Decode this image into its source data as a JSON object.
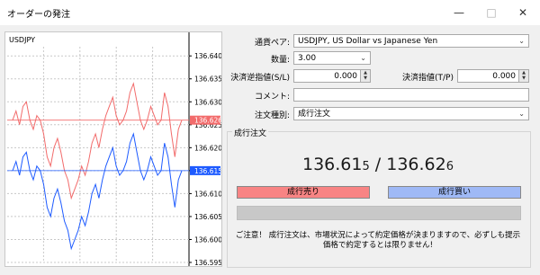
{
  "window": {
    "title": "オーダーの発注",
    "minimize": "—",
    "maximize": "□",
    "close": "✕"
  },
  "chart": {
    "symbol": "USDJPY",
    "ticks": [
      "136.640",
      "136.635",
      "136.630",
      "136.625",
      "136.620",
      "136.615",
      "136.610",
      "136.605",
      "136.600",
      "136.595"
    ],
    "ask_label": "136.626",
    "bid_label": "136.615",
    "colors": {
      "ask": "#f26b6b",
      "bid": "#1e5bff"
    }
  },
  "chart_data": {
    "type": "line",
    "title": "USDJPY",
    "ylim": [
      136.595,
      136.642
    ],
    "series": [
      {
        "values": [
          136.626,
          136.628,
          136.625,
          136.629,
          136.63,
          136.626,
          136.624,
          136.627,
          136.626,
          136.623,
          136.618,
          136.616,
          136.62,
          136.622,
          136.619,
          136.615,
          136.613,
          136.609,
          136.611,
          136.613,
          136.616,
          136.614,
          136.617,
          136.621,
          136.623,
          136.62,
          136.624,
          136.627,
          136.629,
          136.631,
          136.627,
          136.625,
          136.626,
          136.628,
          136.632,
          136.634,
          136.63,
          136.626,
          136.624,
          136.626,
          136.629,
          136.627,
          136.625,
          136.626,
          136.632,
          136.629,
          136.623,
          136.618,
          136.624,
          136.626
        ]
      },
      {
        "values": [
          136.615,
          136.617,
          136.614,
          136.618,
          136.619,
          136.615,
          136.613,
          136.616,
          136.615,
          136.612,
          136.607,
          136.605,
          136.609,
          136.611,
          136.608,
          136.604,
          136.602,
          136.598,
          136.6,
          136.602,
          136.605,
          136.603,
          136.606,
          136.61,
          136.612,
          136.609,
          136.613,
          136.616,
          136.618,
          136.62,
          136.616,
          136.614,
          136.615,
          136.617,
          136.621,
          136.623,
          136.619,
          136.615,
          136.613,
          136.615,
          136.618,
          136.616,
          136.614,
          136.615,
          136.621,
          136.618,
          136.612,
          136.607,
          136.613,
          136.615
        ]
      }
    ]
  },
  "form": {
    "symbol_label": "通貨ペア:",
    "symbol_value": "USDJPY, US Dollar vs Japanese Yen",
    "volume_label": "数量:",
    "volume_value": "3.00",
    "sl_label": "決済逆指値(S/L)",
    "sl_value": "0.000",
    "tp_label": "決済指値(T/P)",
    "tp_value": "0.000",
    "comment_label": "コメント:",
    "comment_value": "",
    "type_label": "注文種別:",
    "type_value": "成行注文"
  },
  "market": {
    "section_title": "成行注文",
    "bid_main": "136.61",
    "bid_last": "5",
    "separator": " / ",
    "ask_main": "136.62",
    "ask_last": "6",
    "sell_label": "成行売り",
    "buy_label": "成行買い",
    "notice_line1": "ご注意！ 成行注文は、市場状況によって約定価格が決まりますので、必ずしも提示",
    "notice_line2": "価格で約定するとは限りません!"
  }
}
